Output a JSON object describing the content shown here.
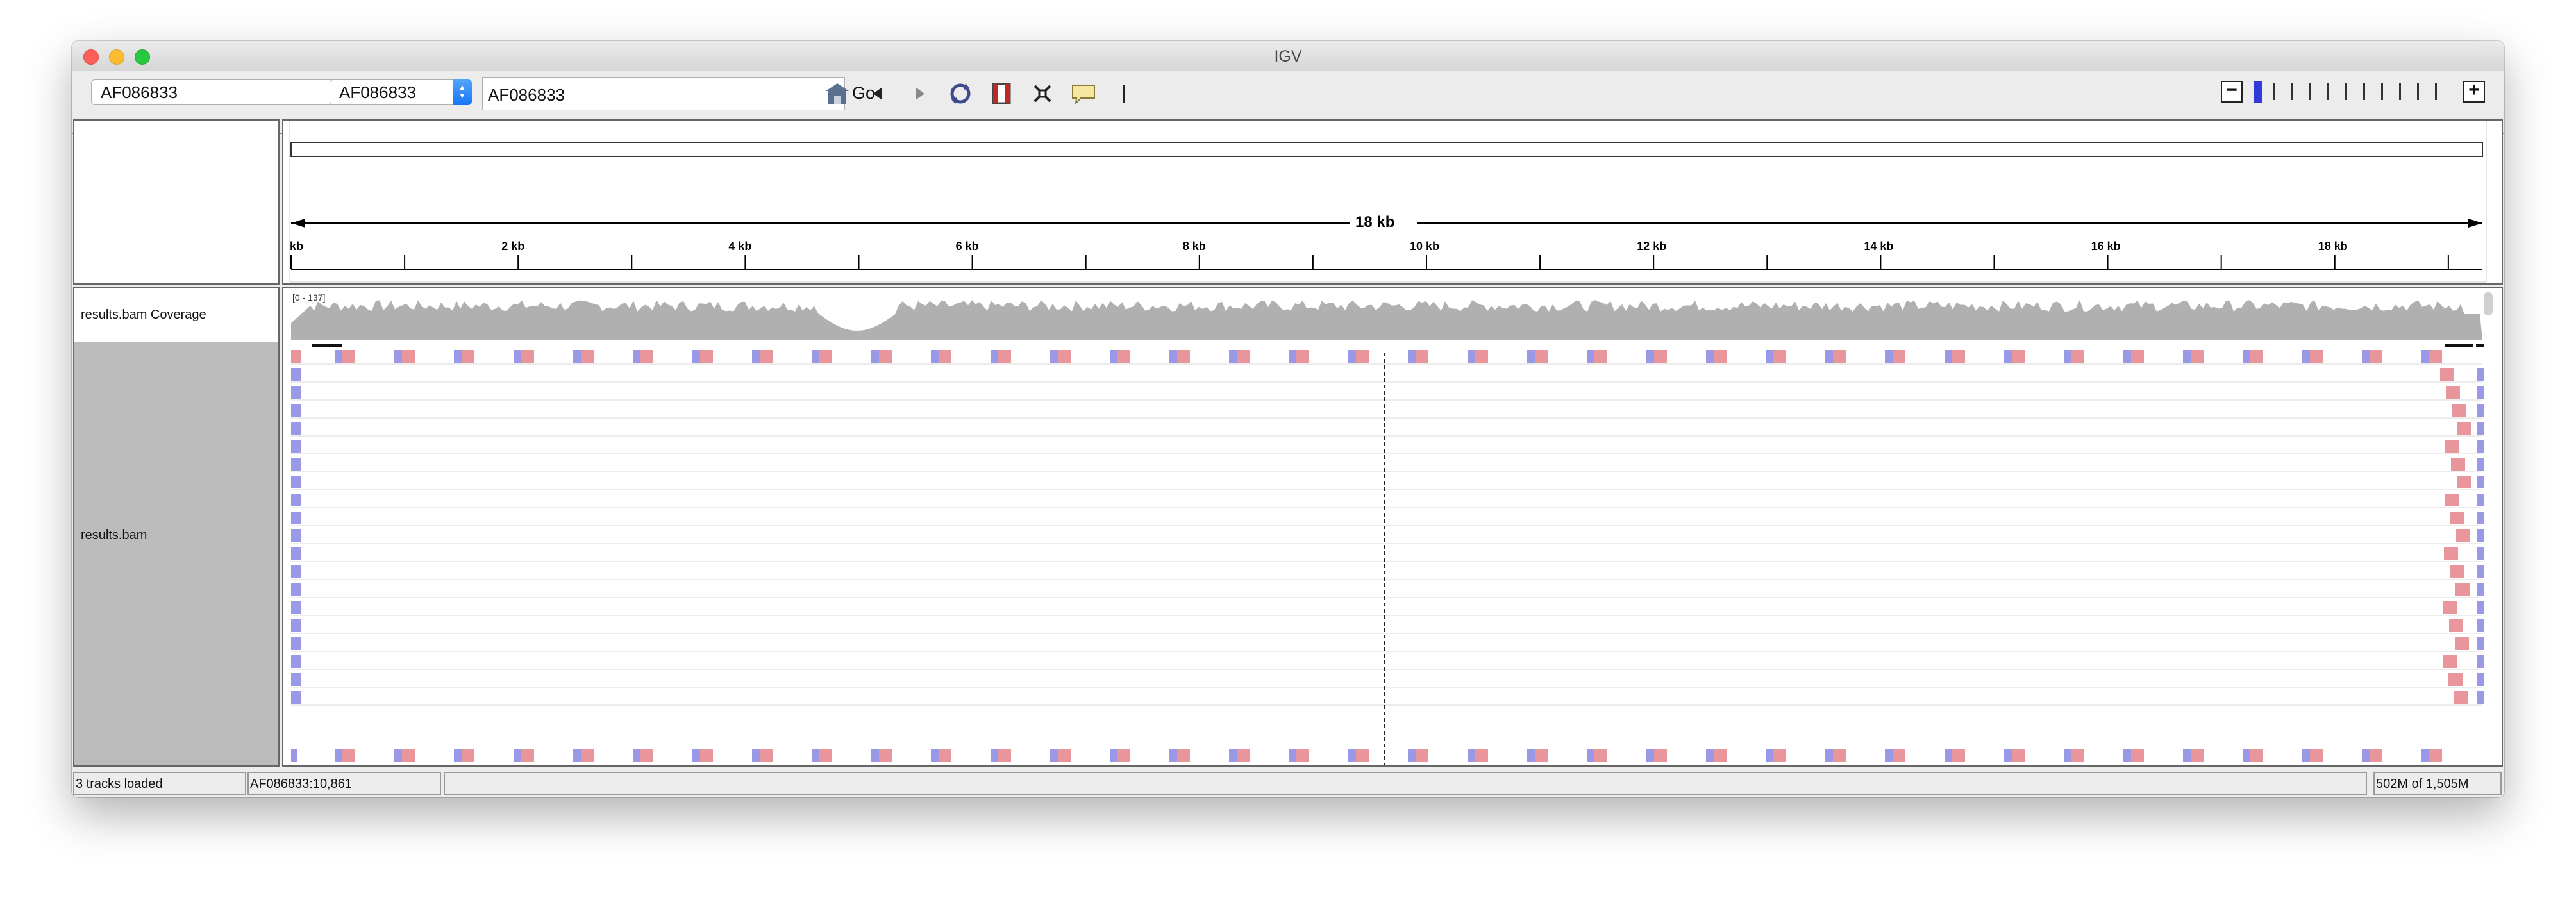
{
  "window": {
    "title": "IGV"
  },
  "toolbar": {
    "genome": "AF086833",
    "chromosome": "AF086833",
    "locus": "AF086833",
    "go_label": "Go",
    "icons": [
      "home-icon",
      "back-icon",
      "forward-icon",
      "refresh-icon",
      "roi-icon",
      "resize-icon",
      "popup-text-icon",
      "ruler-divider-icon"
    ]
  },
  "ruler": {
    "span_label": "18 kb",
    "ticks": [
      "kb",
      "2 kb",
      "4 kb",
      "6 kb",
      "8 kb",
      "10 kb",
      "12 kb",
      "14 kb",
      "16 kb",
      "18 kb"
    ]
  },
  "tracks": {
    "coverage_name": "results.bam Coverage",
    "coverage_range": "[0 - 137]",
    "alignment_name": "results.bam"
  },
  "status": {
    "tracks_loaded": "3 tracks loaded",
    "position": "AF086833:10,861",
    "message": "",
    "memory": "502M of 1,505M"
  },
  "colors": {
    "forward_read": "#e8969b",
    "reverse_read": "#9999e8",
    "coverage": "#b0b0b0",
    "accent": "#2f3adb"
  }
}
